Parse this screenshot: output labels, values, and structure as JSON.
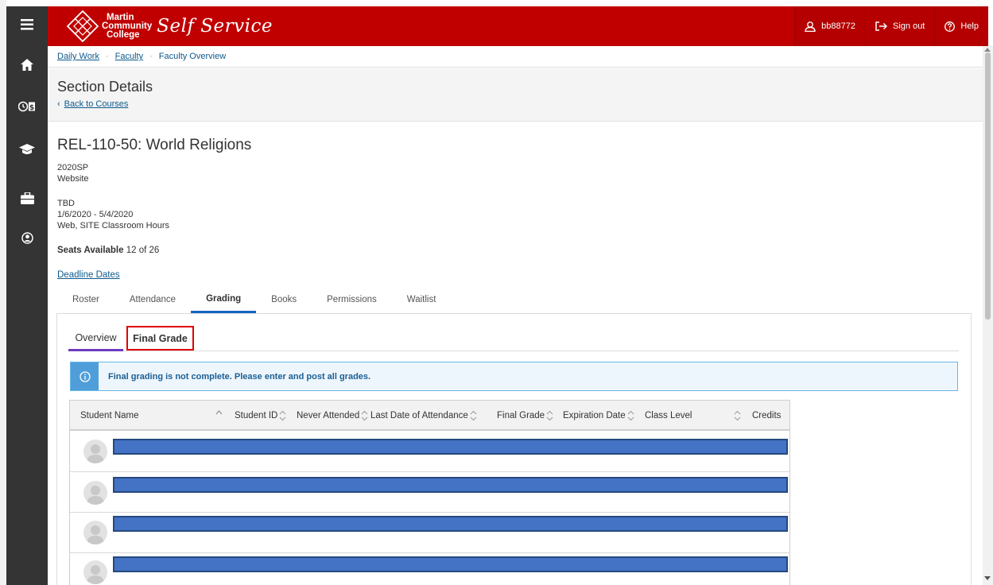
{
  "header": {
    "logo_line1": "Martin",
    "logo_line2": "Community",
    "logo_line3": "College",
    "logo_script": "Self Service",
    "user_label": "bb88772",
    "signout_label": "Sign out",
    "help_label": "Help"
  },
  "nav": {
    "icons": [
      "menu-icon",
      "home-icon",
      "finance-icon",
      "graduation-cap-icon",
      "briefcase-icon",
      "user-circle-icon"
    ]
  },
  "breadcrumb": {
    "items": [
      "Daily Work",
      "Faculty",
      "Faculty Overview"
    ],
    "separator": "·"
  },
  "page": {
    "title": "Section Details",
    "back_label": "Back to Courses"
  },
  "course": {
    "title": "REL-110-50: World Religions",
    "term": "2020SP",
    "location": "Website",
    "time": "TBD",
    "dates": "1/6/2020 - 5/4/2020",
    "method": "Web, SITE Classroom Hours",
    "seats_label": "Seats Available",
    "seats_value": "12 of 26",
    "deadline_link": "Deadline Dates"
  },
  "tabs": [
    "Roster",
    "Attendance",
    "Grading",
    "Books",
    "Permissions",
    "Waitlist"
  ],
  "active_tab": "Grading",
  "subtabs": [
    "Overview",
    "Final Grade"
  ],
  "alert": {
    "message": "Final grading is not complete. Please enter and post all grades."
  },
  "table": {
    "columns": [
      "Student Name",
      "Student ID",
      "Never Attended",
      "Last Date of Attendance",
      "Final Grade",
      "Expiration Date",
      "Class Level",
      "Credits"
    ],
    "row_count": 4
  },
  "colors": {
    "header_red": "#c00000",
    "nav_dark": "#343434",
    "link_blue": "#0f5a8c",
    "tab_active": "#1565c0",
    "subtab_active": "#6d3bbd",
    "highlight_red": "#e00000",
    "redaction_blue": "#4472c4"
  }
}
